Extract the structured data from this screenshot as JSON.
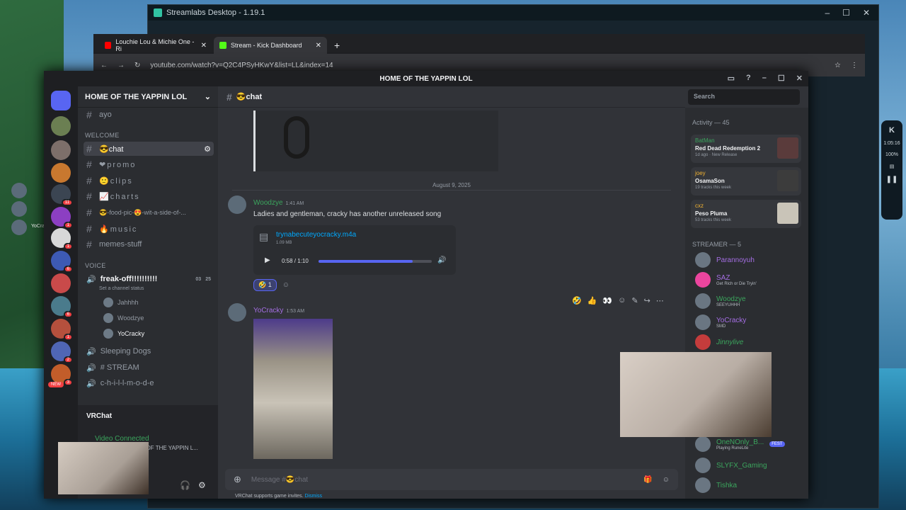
{
  "streamlabs": {
    "title": "Streamlabs Desktop - 1.19.1"
  },
  "chrome": {
    "tabs": [
      {
        "label": "Louchie Lou & Michie One - Ri"
      },
      {
        "label": "Stream - Kick Dashboard"
      }
    ],
    "url": "youtube.com/watch?v=Q2C4PSyHKwY&list=LL&index=14"
  },
  "kick": {
    "time": "1:05:16",
    "volume": "100%"
  },
  "desktop": {
    "user_label": "YoCracky"
  },
  "discord": {
    "title": "HOME OF THE YAPPIN LOL",
    "server_name": "HOME OF THE YAPPIN LOL",
    "new_badge": "NEW",
    "badges": [
      "11",
      "1",
      "1",
      "6",
      "6",
      "1",
      "2",
      "3"
    ],
    "channels": {
      "top": "ayo",
      "welcome_cat": "WELCOME",
      "text": [
        {
          "label": "😎chat"
        },
        {
          "label": "❤promo"
        },
        {
          "label": "🙂clips"
        },
        {
          "label": "📈charts"
        },
        {
          "label": "😎-food-pic-😍-wit-a-side-of-..."
        },
        {
          "label": "🔥music"
        },
        {
          "label": "memes-stuff"
        }
      ],
      "voice_cat": "VOICE",
      "voice": {
        "name": "freak-off!!!!!!!!!!",
        "status": "Set a channel status",
        "count_a": "03",
        "count_b": "25",
        "users": [
          "Jahhhh",
          "Woodzye",
          "YoCracky"
        ]
      },
      "other_voice": [
        "Sleeping Dogs",
        "# STREAM",
        "c-h-i-l-l-m-o-d-e"
      ]
    },
    "vrchat": {
      "label": "VRChat",
      "video": "Video Connected",
      "sub": "freak-off!!!!!!!!!!! / HOME OF THE YAPPIN L..."
    },
    "channel_header": "😎chat",
    "search_placeholder": "Search",
    "date_divider": "August 9, 2025",
    "messages": [
      {
        "author": "Woodzye",
        "time": "1:41 AM",
        "text": "Ladies and gentleman, cracky has another unreleased song",
        "file": "trynabecuteyocracky.m4a",
        "size": "1.09 MB",
        "audio_time": "0:58 / 1:10",
        "reaction_count": "1"
      },
      {
        "author": "YoCracky",
        "time": "1:53 AM"
      }
    ],
    "composer_placeholder": "Message #😎chat",
    "hint": {
      "text": "VRChat supports game invites.",
      "dismiss": "Dismiss"
    },
    "activity": {
      "header": "Activity — 45",
      "items": [
        {
          "user": "BatMan",
          "title": "Red Dead Redemption 2",
          "sub": "1d ago · New Release"
        },
        {
          "user": "joey",
          "title": "OsamaSon",
          "sub": "19 tracks this week"
        },
        {
          "user": "cxz",
          "title": "Peso Pluma",
          "sub": "53 tracks this week"
        }
      ]
    },
    "streamer_header": "STREAMER — 5",
    "members": [
      {
        "name": "Parannoyuh",
        "status": ""
      },
      {
        "name": "SAZ",
        "status": "Get Rich or Die Tryin'"
      },
      {
        "name": "Woodzye",
        "status": "SEEYUHHH"
      },
      {
        "name": "YoCracky",
        "status": "SMD"
      },
      {
        "name": "Jinnylive",
        "status": ""
      },
      {
        "name": "OneNOnly_B...",
        "status": "Playing RuneLite"
      },
      {
        "name": "SLYFX_Gaming",
        "status": ""
      },
      {
        "name": "Tishka",
        "status": ""
      }
    ],
    "fest": "FEST"
  }
}
